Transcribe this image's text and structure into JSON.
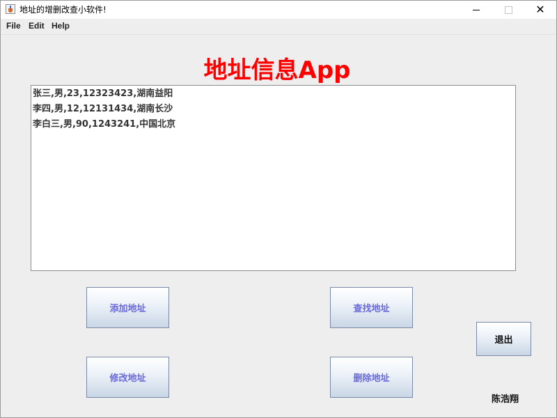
{
  "window": {
    "title": "地址的增删改查小软件!"
  },
  "menu": {
    "items": [
      "File",
      "Edit",
      "Help"
    ]
  },
  "header": {
    "title": "地址信息App"
  },
  "records": [
    "张三,男,23,12323423,湖南益阳",
    "李四,男,12,12131434,湖南长沙",
    "李白三,男,90,1243241,中国北京"
  ],
  "buttons": {
    "add": "添加地址",
    "find": "查找地址",
    "edit": "修改地址",
    "delete": "删除地址",
    "exit": "退出"
  },
  "author": "陈浩翔",
  "colors": {
    "title_red": "#ff0000",
    "button_text_blue": "#6a6adb"
  }
}
